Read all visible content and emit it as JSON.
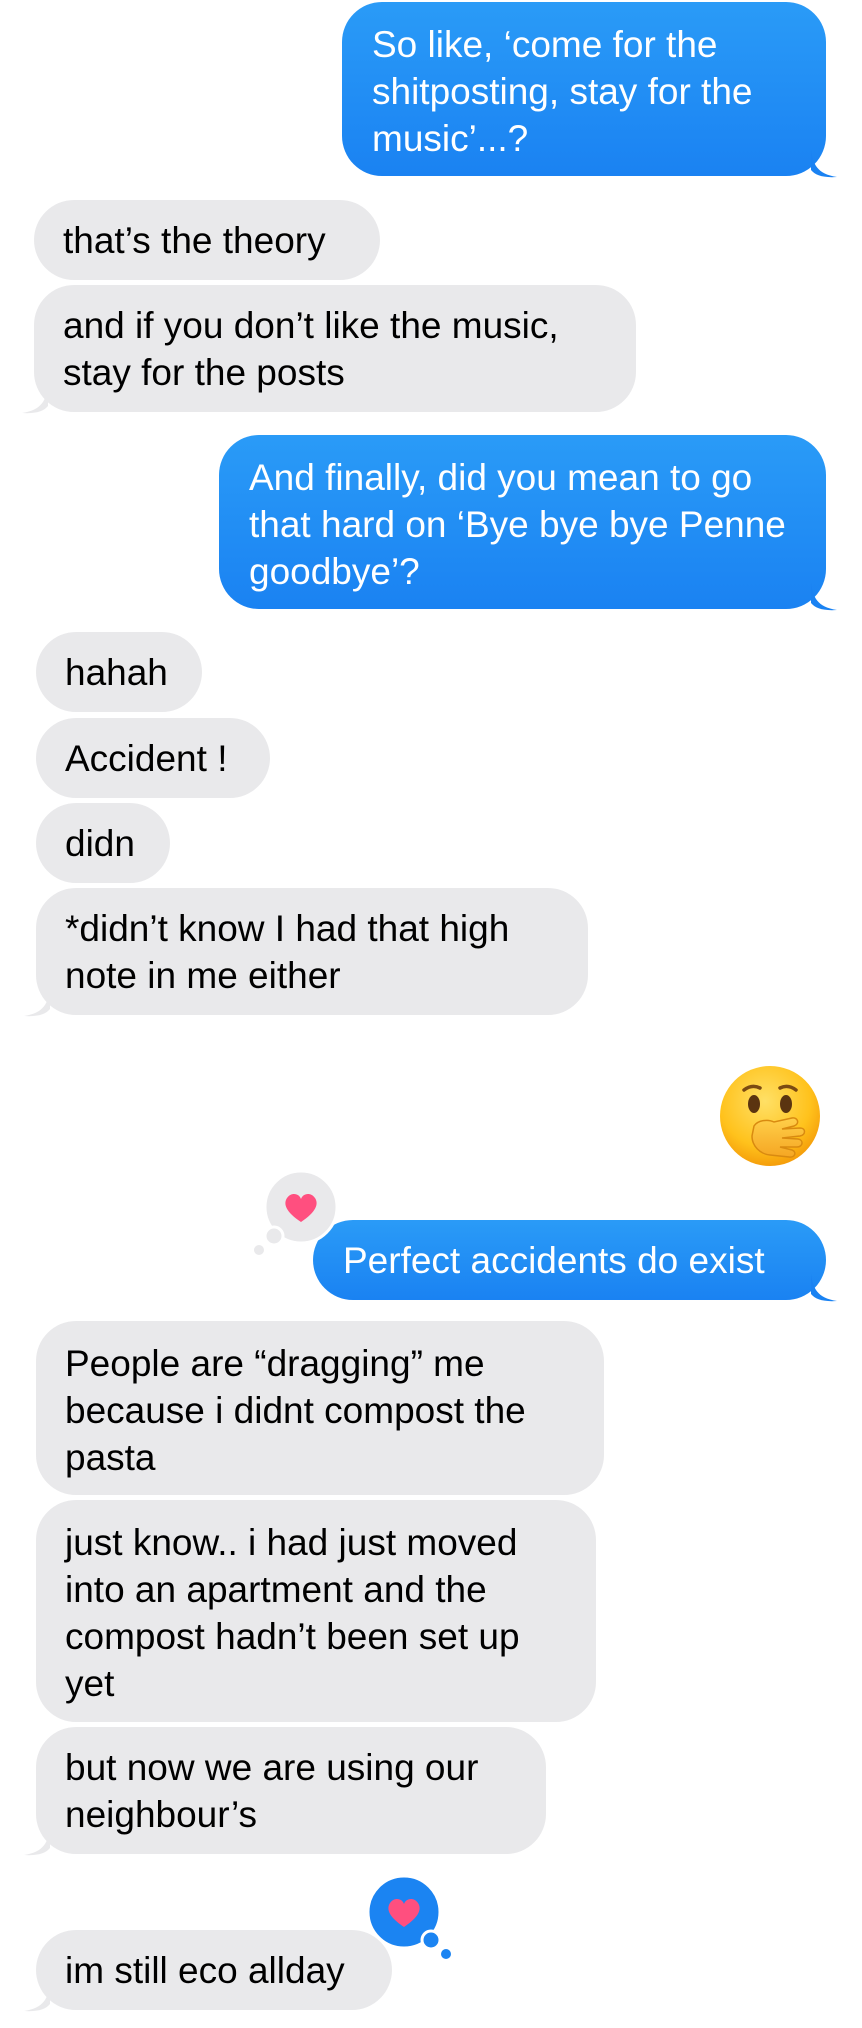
{
  "messages": [
    {
      "side": "sent",
      "text": "So like, ‘come for the shitposting, stay for the music’...?"
    },
    {
      "side": "received",
      "text": "that’s the theory"
    },
    {
      "side": "received",
      "text": "and if you don’t like the music, stay for the posts"
    },
    {
      "side": "sent",
      "text": "And finally, did you mean to go that hard on ‘Bye bye bye Penne goodbye’?"
    },
    {
      "side": "received",
      "text": "hahah"
    },
    {
      "side": "received",
      "text": "Accident !"
    },
    {
      "side": "received",
      "text": "didn"
    },
    {
      "side": "received",
      "text": "*didn’t know I had that high note in me either"
    },
    {
      "side": "sent",
      "emoji": "hand-over-mouth-emoji"
    },
    {
      "side": "sent",
      "text": "Perfect accidents do exist",
      "reaction": "heart-icon"
    },
    {
      "side": "received",
      "text": "People are “dragging” me because i didnt compost the pasta"
    },
    {
      "side": "received",
      "text": "just know.. i had just moved into an apartment and the compost hadn’t been set up yet"
    },
    {
      "side": "received",
      "text": "but now we are using our neighbour’s"
    },
    {
      "side": "received",
      "text": "im still eco allday",
      "reaction": "heart-icon"
    }
  ],
  "colors": {
    "sent_bubble": "#1b84f2",
    "received_bubble": "#e9e9eb",
    "heart": "#ff4f7f",
    "tapback_on_sent": "#e9e9eb",
    "tapback_on_received": "#1b84f2"
  }
}
